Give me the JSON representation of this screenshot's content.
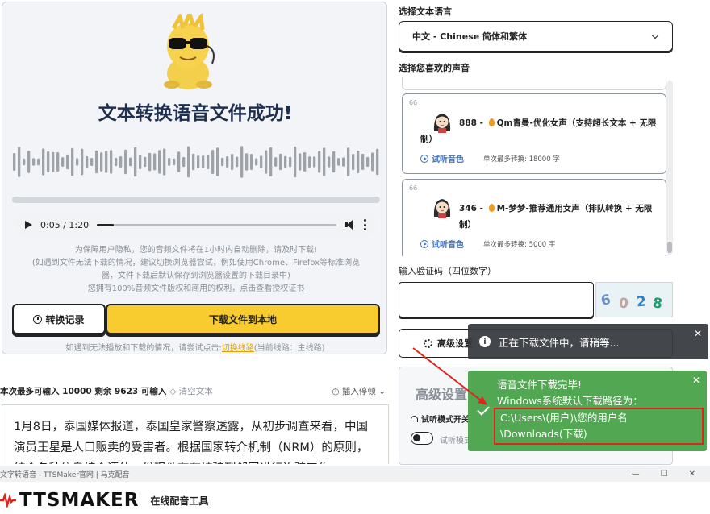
{
  "result": {
    "title": "文本转换语音文件成功!",
    "audio_time": "0:05 / 1:20",
    "audio_progress_percent": 7,
    "notice_lines": [
      "为保障用户隐私，您的音频文件将在1小时内自动删除，请及时下载!",
      "(如遇到文件无法下载的情况，建议切换浏览器尝试，例如使用Chrome、Firefox等标准浏览",
      "器，文件下载后默认保存到浏览器设置的下载目录中)"
    ],
    "copyright_line": "您拥有100%音频文件版权和商用的权利，点击查看授权证书",
    "history_button": "转换记录",
    "download_button": "下载文件到本地",
    "fallback_prefix": "如遇到无法播放和下载的情况，请尝试点击:",
    "fallback_link": "切换线路",
    "fallback_suffix": "(当前线路：主线路)"
  },
  "editor": {
    "counter": "本次最多可输入 10000 剩余 9623 可输入",
    "clear": "◇ 清空文本",
    "insert_pause": "◷ 插入停顿 ⌄",
    "content": "1月8日，泰国媒体报道，泰国皇家警察透露，从初步调查来看，中国演员王星是人口贩卖的受害者。根据国家转介机制（NRM）的原则，结合各种信息综合评估，发现他存在被骗到邻国进行诈骗工作"
  },
  "language": {
    "label": "选择文本语言",
    "selected": "中文 - Chinese 简体和繁体"
  },
  "voices": {
    "label": "选择您喜欢的声音",
    "items": [
      {
        "num": "66",
        "id": "888",
        "name": "Qm青曼-优化女声（支持超长文本 + 无限",
        "name_cont": "制）",
        "preview": "试听音色",
        "limit": "单次最多转换: 18000 字"
      },
      {
        "num": "66",
        "id": "346",
        "name": "M-梦梦-推荐通用女声（排队转换 + 无限制）",
        "name_cont": "",
        "preview": "试听音色",
        "limit": "单次最多转换: 5000 字"
      }
    ]
  },
  "captcha": {
    "label": "输入验证码（四位数字）",
    "value": "",
    "digits": [
      "6",
      "0",
      "2",
      "8"
    ],
    "digit_colors": [
      "#6a8fc8",
      "#c7a2a2",
      "#2f7fc8",
      "#1f9c6a"
    ]
  },
  "advanced": {
    "button": "高级设置",
    "panel_title": "高级设置",
    "trial_label": "试听模式开关",
    "toggle_label": "试听模式"
  },
  "toasts": {
    "downloading": "正在下载文件中，请稍等...",
    "complete_line1": "语音文件下载完毕!",
    "complete_line2": "Windows系统默认下载路径为：",
    "path": "C:\\Users\\(用户)\\您的用户名\\Downloads(下载)",
    "close_glyph": "✕"
  },
  "window": {
    "title": "文字转语音 - TTSMaker官网 | 马克配音",
    "controls": [
      "—",
      "☐",
      "✕"
    ]
  },
  "brand": {
    "name": "TTSMAKER",
    "tagline": "在线配音工具"
  },
  "colors": {
    "accent_yellow": "#f8cb2f",
    "toast_green": "#52a852",
    "toast_dark": "#373a40",
    "highlight_red": "#e0231b",
    "link_blue": "#3a6fc4"
  }
}
